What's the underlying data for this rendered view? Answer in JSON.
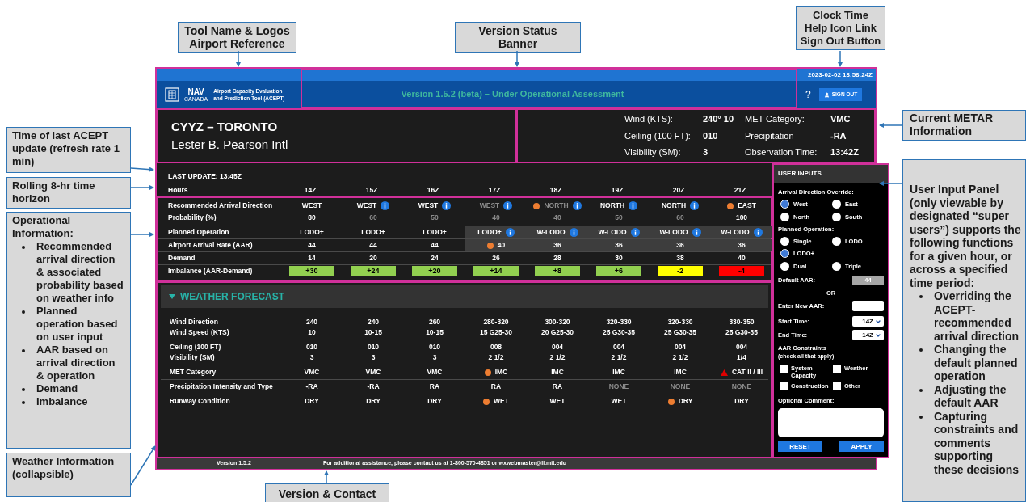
{
  "header": {
    "logo_line1": "NAV",
    "logo_line2": "CANADA",
    "tool_name_lines": [
      "Airport Capacity Evaluation",
      "and Prediction Tool (ACEPT)"
    ],
    "banner": "Version 1.5.2 (beta) – Under Operational Assessment",
    "clock": "2023-02-02 13:58:24Z",
    "help": "?",
    "sign_out": "SIGN OUT"
  },
  "airport": {
    "code": "CYYZ – TORONTO",
    "name": "Lester B. Pearson Intl"
  },
  "metar": [
    {
      "label": "Wind (KTS):",
      "value": "240° 10"
    },
    {
      "label": "MET Category:",
      "value": "VMC"
    },
    {
      "label": "Ceiling (100 FT):",
      "value": "010"
    },
    {
      "label": "Precipitation",
      "value": "-RA"
    },
    {
      "label": "Visibility (SM):",
      "value": "3"
    },
    {
      "label": "Observation Time:",
      "value": "13:42Z"
    }
  ],
  "operations": {
    "last_update": "LAST UPDATE: 13:45Z",
    "hours_label": "Hours",
    "hours": [
      "14Z",
      "15Z",
      "16Z",
      "17Z",
      "18Z",
      "19Z",
      "20Z",
      "21Z"
    ],
    "groups": [
      {
        "rows": [
          {
            "label": "Recommended Arrival Direction",
            "kind": "text",
            "cells": [
              {
                "text": "WEST",
                "muted": false,
                "warning": false,
                "info": false,
                "shaded": false
              },
              {
                "text": "WEST",
                "muted": false,
                "warning": false,
                "info": true,
                "shaded": false
              },
              {
                "text": "WEST",
                "muted": false,
                "warning": false,
                "info": true,
                "shaded": false
              },
              {
                "text": "WEST",
                "muted": true,
                "warning": false,
                "info": true,
                "shaded": false
              },
              {
                "text": "NORTH",
                "muted": true,
                "warning": true,
                "info": true,
                "shaded": false
              },
              {
                "text": "NORTH",
                "muted": false,
                "warning": false,
                "info": true,
                "shaded": false
              },
              {
                "text": "NORTH",
                "muted": false,
                "warning": false,
                "info": true,
                "shaded": false
              },
              {
                "text": "EAST",
                "muted": false,
                "warning": true,
                "info": false,
                "shaded": false
              }
            ]
          },
          {
            "label": "Probability (%)",
            "kind": "text",
            "cells": [
              {
                "text": "80",
                "muted": false,
                "warning": false,
                "info": false,
                "shaded": false
              },
              {
                "text": "60",
                "muted": true,
                "warning": false,
                "info": false,
                "shaded": false
              },
              {
                "text": "50",
                "muted": true,
                "warning": false,
                "info": false,
                "shaded": false
              },
              {
                "text": "40",
                "muted": true,
                "warning": false,
                "info": false,
                "shaded": false
              },
              {
                "text": "40",
                "muted": true,
                "warning": false,
                "info": false,
                "shaded": false
              },
              {
                "text": "50",
                "muted": true,
                "warning": false,
                "info": false,
                "shaded": false
              },
              {
                "text": "60",
                "muted": true,
                "warning": false,
                "info": false,
                "shaded": false
              },
              {
                "text": "100",
                "muted": false,
                "warning": false,
                "info": false,
                "shaded": false
              }
            ]
          }
        ]
      },
      {
        "rows": [
          {
            "label": "Planned Operation",
            "kind": "text",
            "cells": [
              {
                "text": "LODO+",
                "muted": false,
                "warning": false,
                "info": false,
                "shaded": false
              },
              {
                "text": "LODO+",
                "muted": false,
                "warning": false,
                "info": false,
                "shaded": false
              },
              {
                "text": "LODO+",
                "muted": false,
                "warning": false,
                "info": false,
                "shaded": false
              },
              {
                "text": "LODO+",
                "muted": false,
                "warning": false,
                "info": true,
                "shaded": true
              },
              {
                "text": "W-LODO",
                "muted": false,
                "warning": false,
                "info": true,
                "shaded": true
              },
              {
                "text": "W-LODO",
                "muted": false,
                "warning": false,
                "info": true,
                "shaded": true
              },
              {
                "text": "W-LODO",
                "muted": false,
                "warning": false,
                "info": true,
                "shaded": true
              },
              {
                "text": "W-LODO",
                "muted": false,
                "warning": false,
                "info": true,
                "shaded": true
              }
            ]
          }
        ]
      },
      {
        "rows": [
          {
            "label": "Airport Arrival Rate (AAR)",
            "kind": "text",
            "cells": [
              {
                "text": "44",
                "muted": false,
                "warning": false,
                "info": false,
                "shaded": false
              },
              {
                "text": "44",
                "muted": false,
                "warning": false,
                "info": false,
                "shaded": false
              },
              {
                "text": "44",
                "muted": false,
                "warning": false,
                "info": false,
                "shaded": false
              },
              {
                "text": "40",
                "muted": false,
                "warning": true,
                "info": false,
                "shaded": true
              },
              {
                "text": "36",
                "muted": false,
                "warning": false,
                "info": false,
                "shaded": true
              },
              {
                "text": "36",
                "muted": false,
                "warning": false,
                "info": false,
                "shaded": true
              },
              {
                "text": "36",
                "muted": false,
                "warning": false,
                "info": false,
                "shaded": true
              },
              {
                "text": "36",
                "muted": false,
                "warning": false,
                "info": false,
                "shaded": true
              }
            ]
          }
        ]
      },
      {
        "rows": [
          {
            "label": "Demand",
            "kind": "text",
            "cells": [
              {
                "text": "14",
                "muted": false,
                "warning": false,
                "info": false,
                "shaded": false
              },
              {
                "text": "20",
                "muted": false,
                "warning": false,
                "info": false,
                "shaded": false
              },
              {
                "text": "24",
                "muted": false,
                "warning": false,
                "info": false,
                "shaded": false
              },
              {
                "text": "26",
                "muted": false,
                "warning": false,
                "info": false,
                "shaded": false
              },
              {
                "text": "28",
                "muted": false,
                "warning": false,
                "info": false,
                "shaded": false
              },
              {
                "text": "30",
                "muted": false,
                "warning": false,
                "info": false,
                "shaded": false
              },
              {
                "text": "38",
                "muted": false,
                "warning": false,
                "info": false,
                "shaded": false
              },
              {
                "text": "40",
                "muted": false,
                "warning": false,
                "info": false,
                "shaded": false
              }
            ]
          }
        ]
      },
      {
        "rows": [
          {
            "label": "Imbalance (AAR-Demand)",
            "kind": "chips",
            "cells": [
              {
                "text": "+30",
                "color": "#92d050"
              },
              {
                "text": "+24",
                "color": "#92d050"
              },
              {
                "text": "+20",
                "color": "#92d050"
              },
              {
                "text": "+14",
                "color": "#92d050"
              },
              {
                "text": "+8",
                "color": "#92d050"
              },
              {
                "text": "+6",
                "color": "#92d050"
              },
              {
                "text": "-2",
                "color": "#ffff00"
              },
              {
                "text": "-4",
                "color": "#ff0000"
              }
            ]
          }
        ]
      }
    ]
  },
  "weather": {
    "title": "WEATHER FORECAST",
    "expanded": true,
    "groups": [
      {
        "rows": [
          {
            "label": "Wind Direction",
            "cells": [
              {
                "text": "240",
                "muted": false,
                "warning": false,
                "critical": false
              },
              {
                "text": "240",
                "muted": false,
                "warning": false,
                "critical": false
              },
              {
                "text": "260",
                "muted": false,
                "warning": false,
                "critical": false
              },
              {
                "text": "280-320",
                "muted": false,
                "warning": false,
                "critical": false
              },
              {
                "text": "300-320",
                "muted": false,
                "warning": false,
                "critical": false
              },
              {
                "text": "320-330",
                "muted": false,
                "warning": false,
                "critical": false
              },
              {
                "text": "320-330",
                "muted": false,
                "warning": false,
                "critical": false
              },
              {
                "text": "330-350",
                "muted": false,
                "warning": false,
                "critical": false
              }
            ]
          },
          {
            "label": "Wind Speed (KTS)",
            "cells": [
              {
                "text": "10",
                "muted": false,
                "warning": false,
                "critical": false
              },
              {
                "text": "10-15",
                "muted": false,
                "warning": false,
                "critical": false
              },
              {
                "text": "10-15",
                "muted": false,
                "warning": false,
                "critical": false
              },
              {
                "text": "15 G25-30",
                "muted": false,
                "warning": false,
                "critical": false
              },
              {
                "text": "20 G25-30",
                "muted": false,
                "warning": false,
                "critical": false
              },
              {
                "text": "25 G30-35",
                "muted": false,
                "warning": false,
                "critical": false
              },
              {
                "text": "25 G30-35",
                "muted": false,
                "warning": false,
                "critical": false
              },
              {
                "text": "25 G30-35",
                "muted": false,
                "warning": false,
                "critical": false
              }
            ]
          }
        ]
      },
      {
        "rows": [
          {
            "label": "Ceiling (100 FT)",
            "cells": [
              {
                "text": "010",
                "muted": false,
                "warning": false,
                "critical": false
              },
              {
                "text": "010",
                "muted": false,
                "warning": false,
                "critical": false
              },
              {
                "text": "010",
                "muted": false,
                "warning": false,
                "critical": false
              },
              {
                "text": "008",
                "muted": false,
                "warning": false,
                "critical": false
              },
              {
                "text": "004",
                "muted": false,
                "warning": false,
                "critical": false
              },
              {
                "text": "004",
                "muted": false,
                "warning": false,
                "critical": false
              },
              {
                "text": "004",
                "muted": false,
                "warning": false,
                "critical": false
              },
              {
                "text": "004",
                "muted": false,
                "warning": false,
                "critical": false
              }
            ]
          },
          {
            "label": "Visibility (SM)",
            "cells": [
              {
                "text": "3",
                "muted": false,
                "warning": false,
                "critical": false
              },
              {
                "text": "3",
                "muted": false,
                "warning": false,
                "critical": false
              },
              {
                "text": "3",
                "muted": false,
                "warning": false,
                "critical": false
              },
              {
                "text": "2 1/2",
                "muted": false,
                "warning": false,
                "critical": false
              },
              {
                "text": "2 1/2",
                "muted": false,
                "warning": false,
                "critical": false
              },
              {
                "text": "2 1/2",
                "muted": false,
                "warning": false,
                "critical": false
              },
              {
                "text": "2 1/2",
                "muted": false,
                "warning": false,
                "critical": false
              },
              {
                "text": "1/4",
                "muted": false,
                "warning": false,
                "critical": false
              }
            ]
          }
        ]
      },
      {
        "rows": [
          {
            "label": "MET Category",
            "cells": [
              {
                "text": "VMC",
                "muted": false,
                "warning": false,
                "critical": false
              },
              {
                "text": "VMC",
                "muted": false,
                "warning": false,
                "critical": false
              },
              {
                "text": "VMC",
                "muted": false,
                "warning": false,
                "critical": false
              },
              {
                "text": "IMC",
                "muted": false,
                "warning": true,
                "critical": false
              },
              {
                "text": "IMC",
                "muted": false,
                "warning": false,
                "critical": false
              },
              {
                "text": "IMC",
                "muted": false,
                "warning": false,
                "critical": false
              },
              {
                "text": "IMC",
                "muted": false,
                "warning": false,
                "critical": false
              },
              {
                "text": "CAT II / III",
                "muted": false,
                "warning": false,
                "critical": true
              }
            ]
          }
        ]
      },
      {
        "rows": [
          {
            "label": "Precipitation Intensity and Type",
            "cells": [
              {
                "text": "-RA",
                "muted": false,
                "warning": false,
                "critical": false
              },
              {
                "text": "-RA",
                "muted": false,
                "warning": false,
                "critical": false
              },
              {
                "text": "RA",
                "muted": false,
                "warning": false,
                "critical": false
              },
              {
                "text": "RA",
                "muted": false,
                "warning": false,
                "critical": false
              },
              {
                "text": "RA",
                "muted": false,
                "warning": false,
                "critical": false
              },
              {
                "text": "NONE",
                "muted": true,
                "warning": false,
                "critical": false
              },
              {
                "text": "NONE",
                "muted": true,
                "warning": false,
                "critical": false
              },
              {
                "text": "NONE",
                "muted": true,
                "warning": false,
                "critical": false
              }
            ]
          }
        ]
      },
      {
        "rows": [
          {
            "label": "Runway Condition",
            "cells": [
              {
                "text": "DRY",
                "muted": false,
                "warning": false,
                "critical": false
              },
              {
                "text": "DRY",
                "muted": false,
                "warning": false,
                "critical": false
              },
              {
                "text": "DRY",
                "muted": false,
                "warning": false,
                "critical": false
              },
              {
                "text": "WET",
                "muted": false,
                "warning": true,
                "critical": false
              },
              {
                "text": "WET",
                "muted": false,
                "warning": false,
                "critical": false
              },
              {
                "text": "WET",
                "muted": false,
                "warning": false,
                "critical": false
              },
              {
                "text": "DRY",
                "muted": false,
                "warning": true,
                "critical": false
              },
              {
                "text": "DRY",
                "muted": false,
                "warning": false,
                "critical": false
              }
            ]
          }
        ]
      }
    ]
  },
  "user_inputs": {
    "title": "USER INPUTS",
    "direction_label": "Arrival Direction Override:",
    "direction_rows": [
      [
        {
          "label": "West",
          "selected": true
        },
        {
          "label": "East",
          "selected": false
        }
      ],
      [
        {
          "label": "North",
          "selected": false
        },
        {
          "label": "South",
          "selected": false
        }
      ]
    ],
    "operation_label": "Planned Operation:",
    "operation_rows": [
      [
        {
          "label": "Single",
          "selected": false
        },
        {
          "label": "LODO",
          "selected": false
        }
      ],
      [
        {
          "label": "LODO+",
          "selected": true
        }
      ],
      [
        {
          "label": "Dual",
          "selected": false
        },
        {
          "label": "Triple",
          "selected": false
        }
      ]
    ],
    "default_aar_label": "Default AAR:",
    "default_aar": "44",
    "or": "OR",
    "new_aar_label": "Enter New AAR:",
    "start_label": "Start Time:",
    "start_value": "14Z",
    "end_label": "End Time:",
    "end_value": "14Z",
    "constraints_label": "AAR Constraints",
    "constraints_hint": "(check all that apply)",
    "constraint_rows": [
      [
        {
          "label": "System Capacity",
          "checked": false
        },
        {
          "label": "Weather",
          "checked": false
        }
      ],
      [
        {
          "label": "Construction",
          "checked": false
        },
        {
          "label": "Other",
          "checked": false
        }
      ]
    ],
    "comment_label": "Optional Comment:",
    "buttons": [
      "RESET",
      "APPLY"
    ]
  },
  "footer": {
    "version": "Version 1.5.2",
    "contact": "For additional assistance, please contact us at 1-800-570-4851 or wxwebmaster@ll.mit.edu"
  },
  "callouts": {
    "top": [
      {
        "lines": [
          "Tool Name & Logos",
          "Airport Reference"
        ]
      },
      {
        "lines": [
          "Version Status",
          "Banner"
        ]
      },
      {
        "lines": [
          "Clock Time",
          "Help Icon Link",
          "Sign Out Button"
        ]
      }
    ],
    "left": [
      {
        "text": "Time of last ACEPT update (refresh rate 1 min)"
      },
      {
        "text": "Rolling 8-hr time horizon"
      },
      {
        "text": "Operational Information:",
        "bullets": [
          "Recommended arrival direction & associated probability based on weather info",
          "Planned operation based on user input",
          "AAR based on arrival direction & operation",
          "Demand",
          "Imbalance"
        ]
      },
      {
        "text": "Weather Information (collapsible)"
      }
    ],
    "right": [
      {
        "text": "Current METAR Information"
      },
      {
        "text": "User Input Panel (only viewable by designated “super users”) supports the following functions for a given hour, or across a specified time period:",
        "bullets": [
          "Overriding the ACEPT-recommended arrival direction",
          "Changing the default planned operation",
          "Adjusting the default AAR",
          "Capturing constraints and comments supporting these decisions"
        ]
      }
    ],
    "bottom": [
      {
        "text": "Version & Contact"
      }
    ]
  }
}
